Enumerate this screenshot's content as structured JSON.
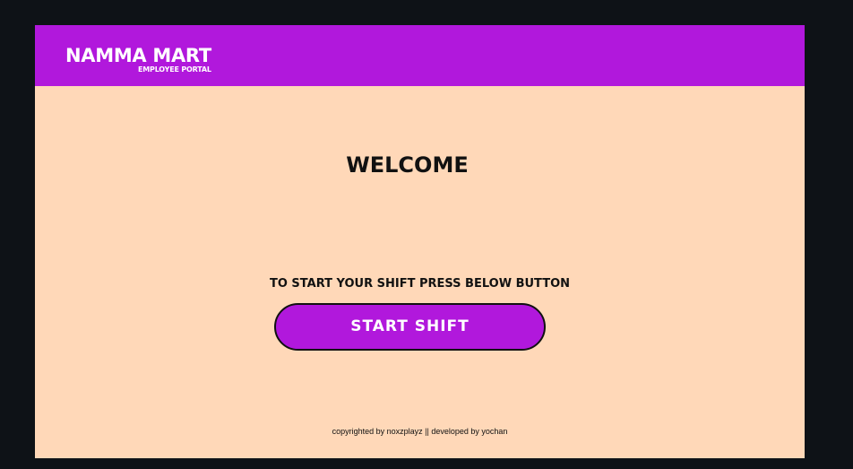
{
  "header": {
    "brand_name": "NAMMA MART",
    "brand_subtitle": "EMPLOYEE PORTAL"
  },
  "main": {
    "title": "WELCOME",
    "instruction": "TO START YOUR SHIFT PRESS BELOW BUTTON",
    "start_button_label": "START SHIFT"
  },
  "footer": {
    "text": "copyrighted by noxzplayz || developed by yochan"
  },
  "colors": {
    "background_outer": "#0e1217",
    "page_background": "#ffd8b8",
    "accent": "#b118dc",
    "text_dark": "#111111",
    "text_light": "#ffffff"
  }
}
